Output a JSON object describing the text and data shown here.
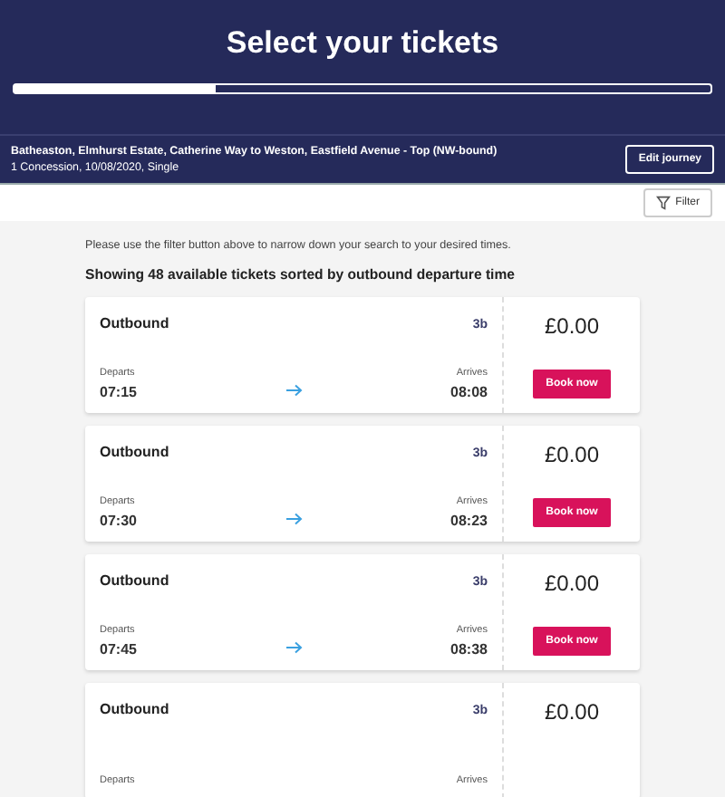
{
  "header": {
    "title": "Select your tickets",
    "progress": {
      "level": 0.29
    }
  },
  "journey": {
    "route": "Batheaston, Elmhurst Estate, Catherine Way to Weston, Eastfield Avenue - Top (NW-bound)",
    "details": "1 Concession, 10/08/2020, Single",
    "edit_button": "Edit journey"
  },
  "filter_button": "Filter",
  "hint": "Please use the filter button above to narrow down your search to your desired times.",
  "summary": "Showing 48 available tickets sorted by outbound departure time",
  "tickets": [
    {
      "direction": "Outbound",
      "route": "3b",
      "departs_label": "Departs",
      "departs": "07:15",
      "arrives_label": "Arrives",
      "arrives": "08:08",
      "price": "£0.00",
      "book_button": "Book now"
    },
    {
      "direction": "Outbound",
      "route": "3b",
      "departs_label": "Departs",
      "departs": "07:30",
      "arrives_label": "Arrives",
      "arrives": "08:23",
      "price": "£0.00",
      "book_button": "Book now"
    },
    {
      "direction": "Outbound",
      "route": "3b",
      "departs_label": "Departs",
      "departs": "07:45",
      "arrives_label": "Arrives",
      "arrives": "08:38",
      "price": "£0.00",
      "book_button": "Book now"
    },
    {
      "direction": "Outbound",
      "route": "3b",
      "departs_label": "Departs",
      "arrives_label": "Arrives",
      "price": "£0.00"
    }
  ]
}
